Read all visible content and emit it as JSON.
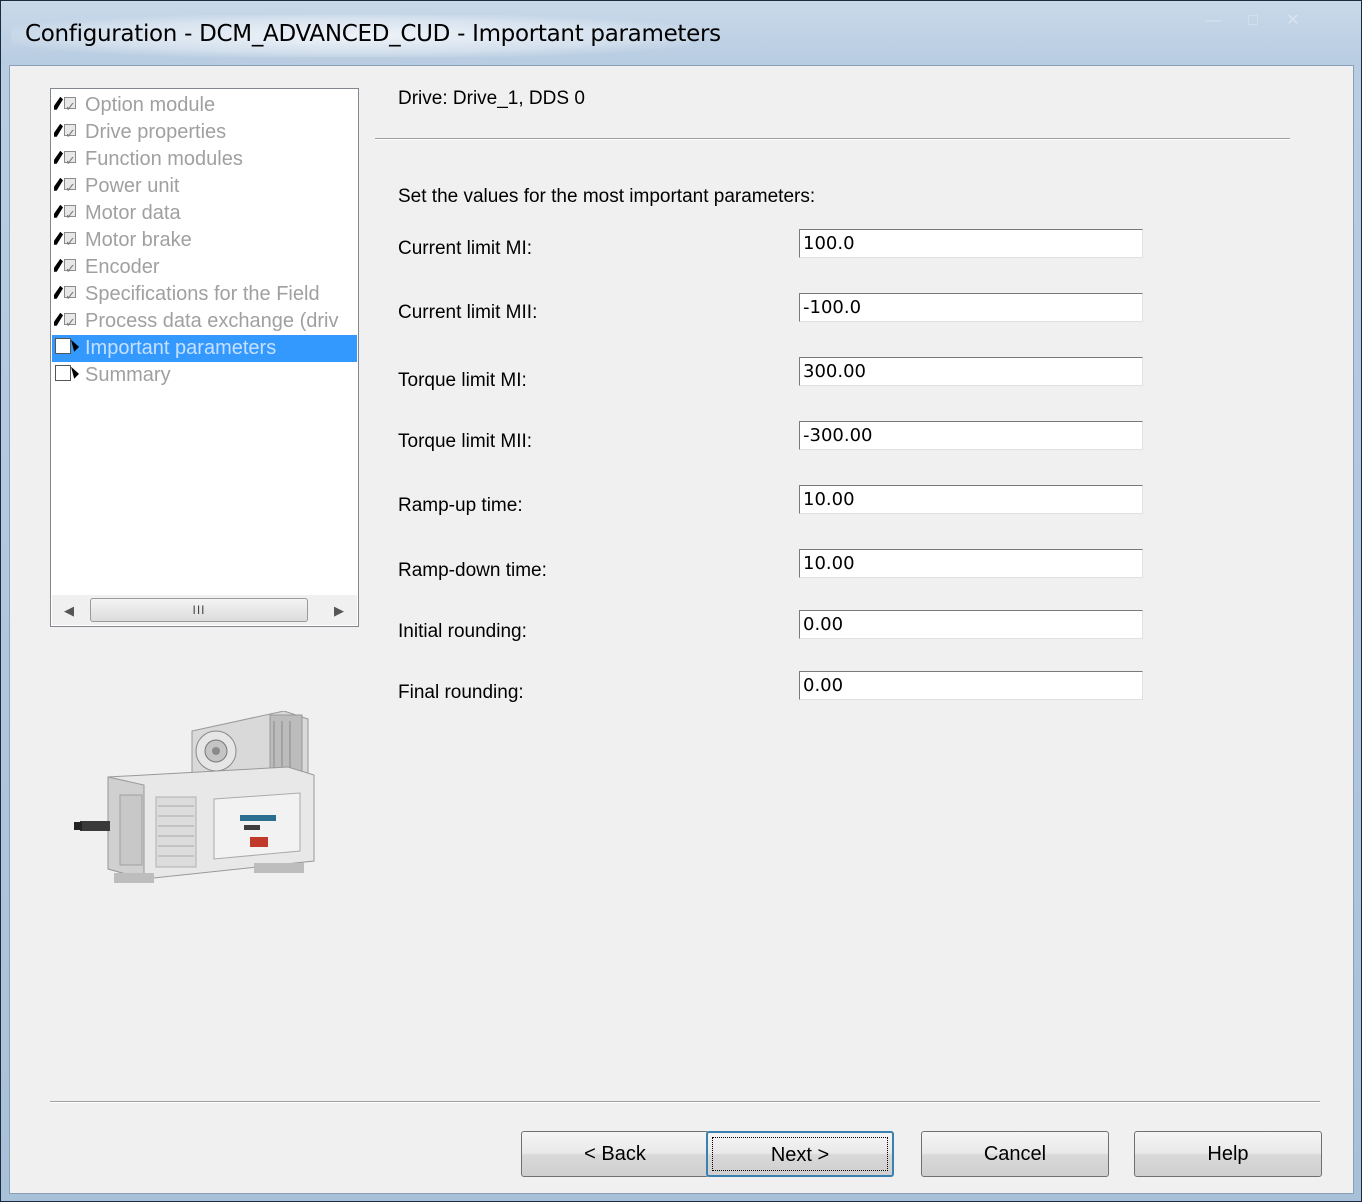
{
  "window": {
    "title": "Configuration - DCM_ADVANCED_CUD - Important parameters",
    "caption_buttons": [
      "minimize",
      "maximize",
      "close"
    ]
  },
  "tree": {
    "items": [
      {
        "label": "Option module",
        "state": "done"
      },
      {
        "label": "Drive properties",
        "state": "done"
      },
      {
        "label": "Function modules",
        "state": "done"
      },
      {
        "label": "Power unit",
        "state": "done"
      },
      {
        "label": "Motor data",
        "state": "done"
      },
      {
        "label": "Motor brake",
        "state": "done"
      },
      {
        "label": "Encoder",
        "state": "done"
      },
      {
        "label": "Specifications for the Field",
        "state": "done"
      },
      {
        "label": "Process data exchange (driv",
        "state": "done"
      },
      {
        "label": "Important parameters",
        "state": "current",
        "selected": true
      },
      {
        "label": "Summary",
        "state": "pending"
      }
    ],
    "scrollbar_thumb_label": "III"
  },
  "header": {
    "drive_label": "Drive: Drive_1, DDS 0"
  },
  "main": {
    "instruction": "Set the values for the most important parameters:",
    "params": [
      {
        "label": "Current limit MI:",
        "value": "100.0"
      },
      {
        "label": "Current limit MII:",
        "value": "-100.0"
      },
      {
        "label": "Torque limit MI:",
        "value": "300.00"
      },
      {
        "label": "Torque limit MII:",
        "value": "-300.00"
      },
      {
        "label": "Ramp-up time:",
        "value": "10.00"
      },
      {
        "label": "Ramp-down time:",
        "value": "10.00"
      },
      {
        "label": "Initial rounding:",
        "value": "0.00"
      },
      {
        "label": "Final rounding:",
        "value": "0.00"
      }
    ]
  },
  "buttons": {
    "back": "< Back",
    "next": "Next >",
    "cancel": "Cancel",
    "help": "Help"
  },
  "colors": {
    "selection": "#3399ff",
    "disabled_text": "#a0a0a0",
    "dialog_bg": "#f0f0f0"
  },
  "icons": {
    "done": "pencil-checkbox-checked-icon",
    "current": "checkbox-arrow-icon",
    "pending": "checkbox-arrow-icon",
    "motor": "dc-motor-image"
  }
}
